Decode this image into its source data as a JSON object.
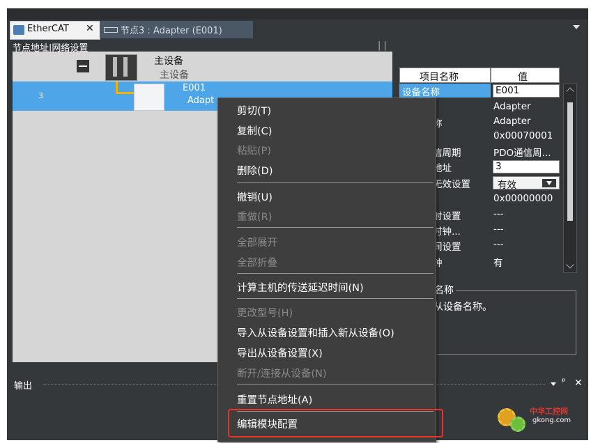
{
  "tabs": [
    {
      "label": "EtherCAT",
      "close": "✕"
    },
    {
      "label": "节点3 : Adapter (E001)"
    }
  ],
  "network": {
    "header": "节点地址|网络设置",
    "master": {
      "title": "主设备",
      "subtitle": "主设备"
    },
    "slave": {
      "node": "3",
      "name": "E001",
      "model": "Adapt"
    }
  },
  "properties": {
    "col_name": "项目名称",
    "col_value": "值",
    "rows": [
      {
        "name": "设备名称",
        "value": "E001"
      },
      {
        "name": "",
        "value": "Adapter"
      },
      {
        "name": "称",
        "value": "Adapter"
      },
      {
        "name": "",
        "value": "0x00070001"
      },
      {
        "name": "信周期",
        "value": "PDO通信周..."
      },
      {
        "name": "地址",
        "value": "3"
      },
      {
        "name": "无效设置",
        "value": "有效"
      },
      {
        "name": "",
        "value": "0x00000000"
      },
      {
        "name": "射设置",
        "value": "---"
      },
      {
        "name": "时钟...",
        "value": "---"
      },
      {
        "name": "间设置",
        "value": "---"
      },
      {
        "name": "钟",
        "value": "有"
      }
    ],
    "desc_title": "名称",
    "desc_text": "从设备名称。"
  },
  "output": {
    "label": "输出",
    "pin": "ᵖ",
    "close": "✕"
  },
  "context_menu": {
    "items": [
      {
        "label": "剪切(T)",
        "enabled": true
      },
      {
        "label": "复制(C)",
        "enabled": true
      },
      {
        "label": "粘贴(P)",
        "enabled": false
      },
      {
        "label": "删除(D)",
        "enabled": true
      },
      {
        "label": "撤销(U)",
        "enabled": true
      },
      {
        "label": "重做(R)",
        "enabled": false
      },
      {
        "label": "全部展开",
        "enabled": false
      },
      {
        "label": "全部折叠",
        "enabled": false
      },
      {
        "label": "计算主机的传送延迟时间(N)",
        "enabled": true
      },
      {
        "label": "更改型号(H)",
        "enabled": false
      },
      {
        "label": "导入从设备设置和插入新从设备(O)",
        "enabled": true
      },
      {
        "label": "导出从设备设置(X)",
        "enabled": true
      },
      {
        "label": "断开/连接从设备(N)",
        "enabled": false
      },
      {
        "label": "重置节点地址(A)",
        "enabled": true
      },
      {
        "label": "编辑模块配置",
        "enabled": true
      }
    ]
  },
  "watermark": {
    "line1": "中华工控网",
    "line2": "gkong.com"
  },
  "colors": {
    "selection": "#4ea6e8",
    "highlight_box": "#e8322a",
    "menu_bg": "#3e3e3e"
  }
}
